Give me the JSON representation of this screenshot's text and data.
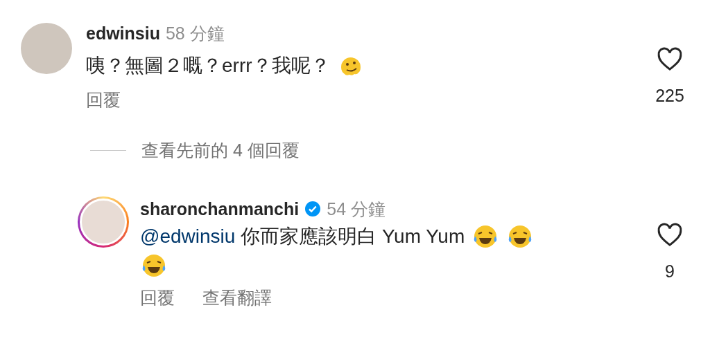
{
  "comment": {
    "username": "edwinsiu",
    "time": "58 分鐘",
    "text": "咦？無圖２嘅？errr？我呢？",
    "likes": "225",
    "liked": false,
    "actions": [
      "回覆"
    ]
  },
  "view_replies": "查看先前的 4 個回覆",
  "reply": {
    "username": "sharonchanmanchi",
    "verified": true,
    "time": "54 分鐘",
    "mention": "@edwinsiu",
    "text": "你而家應該明白 Yum Yum",
    "likes": "9",
    "liked": false,
    "actions": [
      "回覆",
      "查看翻譯"
    ]
  }
}
